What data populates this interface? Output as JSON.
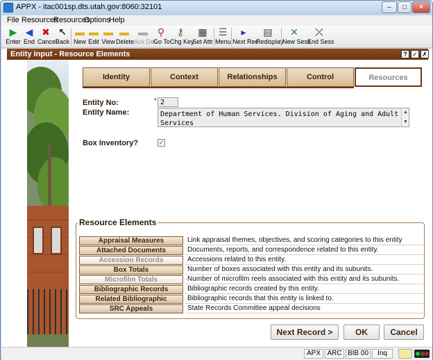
{
  "window": {
    "title": "APPX - itac001sp.dts.utah.gov:8060:32101",
    "min_glyph": "–",
    "max_glyph": "□",
    "close_glyph": "×"
  },
  "menubar": [
    "File",
    "Resources",
    "Resources",
    "Options",
    "Help"
  ],
  "toolbar": {
    "buttons": [
      {
        "label": "Enter",
        "icon": "play-icon",
        "glyph": "▶",
        "color": "#1a9a2a"
      },
      {
        "label": "End",
        "icon": "back-arrow-icon",
        "glyph": "◀",
        "color": "#1a4fc0"
      },
      {
        "label": "Cancel",
        "icon": "cancel-icon",
        "glyph": "✖",
        "color": "#d01010"
      },
      {
        "label": "Back",
        "icon": "pointer-icon",
        "glyph": "↖",
        "color": "#222"
      },
      {
        "label": "New",
        "icon": "folder-icon",
        "glyph": "▬",
        "color": "#e0b020"
      },
      {
        "label": "Edit",
        "icon": "folder-icon",
        "glyph": "▬",
        "color": "#e0b020"
      },
      {
        "label": "View",
        "icon": "folder-icon",
        "glyph": "▬",
        "color": "#e0b020"
      },
      {
        "label": "Delete",
        "icon": "folder-delete-icon",
        "glyph": "▬",
        "color": "#e0b020"
      },
      {
        "label": "Ack Del",
        "icon": "ack-delete-icon",
        "glyph": "▬",
        "color": "#aaaaaa"
      },
      {
        "label": "Go To",
        "icon": "magnifier-icon",
        "glyph": "⚲",
        "color": "#b03020"
      },
      {
        "label": "Chg Key",
        "icon": "key-icon",
        "glyph": "⚷",
        "color": "#7a4a10"
      },
      {
        "label": "Set Attr",
        "icon": "attributes-icon",
        "glyph": "▦",
        "color": "#333"
      },
      {
        "label": "Menu",
        "icon": "menu-icon",
        "glyph": "☰",
        "color": "#2a7a2a"
      },
      {
        "label": "Next Rec",
        "icon": "next-record-icon",
        "glyph": "▸",
        "color": "#1a3a9a"
      },
      {
        "label": "Redisplay",
        "icon": "redisplay-icon",
        "glyph": "▤",
        "color": "#444"
      },
      {
        "label": "New Sess",
        "icon": "new-session-icon",
        "glyph": "✕",
        "color": "#1a7aa0"
      },
      {
        "label": "End Sess",
        "icon": "end-session-icon",
        "glyph": "⤫",
        "color": "#1a7aa0"
      }
    ]
  },
  "form": {
    "header": "Entity Input - Resource Elements",
    "header_buttons": [
      "?",
      "✓",
      "✗"
    ]
  },
  "tabs": [
    {
      "label": "Identity",
      "active": false
    },
    {
      "label": "Context",
      "active": false
    },
    {
      "label": "Relationships",
      "active": false
    },
    {
      "label": "Control",
      "active": false
    },
    {
      "label": "Resources",
      "active": true
    }
  ],
  "fields": {
    "entity_no": {
      "label": "Entity No:",
      "value": "2",
      "required_marker": "*"
    },
    "entity_name": {
      "label": "Entity Name:",
      "value": "Department of Human Services. Division of Aging and Adult Services"
    },
    "box_inventory": {
      "label": "Box Inventory?",
      "checked": true,
      "check_glyph": "✓"
    }
  },
  "resource_elements": {
    "title": "Resource Elements",
    "rows": [
      {
        "button": "Appraisal Measures",
        "description": "Link appraisal themes, objectives, and scoring categories to this entity",
        "enabled": true
      },
      {
        "button": "Attached Documents",
        "description": "Documents, reports, and correspondence related to this entity.",
        "enabled": true
      },
      {
        "button": "Accession Records",
        "description": "Accessions related to this entity.",
        "enabled": false
      },
      {
        "button": "Box Totals",
        "description": "Number of boxes associated with this entity and its subunits.",
        "enabled": true
      },
      {
        "button": "Microfilm Totals",
        "description": "Number of microfilm reels associated with this entity and its subunits.",
        "enabled": false
      },
      {
        "button": "Bibliographic Records",
        "description": "Bibliographic records created by this entity.",
        "enabled": true
      },
      {
        "button": "Related Bibliographic",
        "description": "Bibliographic records that this entity is linked to.",
        "enabled": true
      },
      {
        "button": "SRC Appeals",
        "description": "State Records Committee appeal decisions",
        "enabled": true
      }
    ]
  },
  "buttons": {
    "next_record": "Next Record >",
    "ok": "OK",
    "cancel": "Cancel"
  },
  "statusbar": [
    "APX",
    "ARC",
    "BIB 00",
    "Inq"
  ],
  "colors": {
    "accent_brown": "#6b3510",
    "tab_fill": "#d9bb93",
    "required": "#c00000"
  }
}
